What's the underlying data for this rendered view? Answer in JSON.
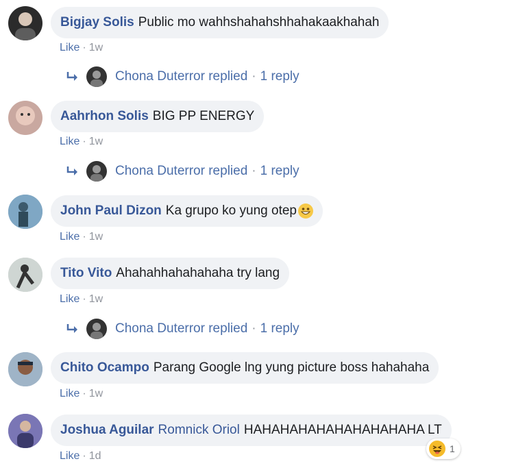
{
  "comments": [
    {
      "author": "Bigjay Solis",
      "text": "Public mo wahhshahahshhahakaakhahah",
      "like": "Like",
      "age": "1w",
      "replies": {
        "name": "Chona Duterror replied",
        "count": "1 reply"
      }
    },
    {
      "author": "Aahrhon Solis",
      "text": "BIG PP ENERGY",
      "like": "Like",
      "age": "1w",
      "replies": {
        "name": "Chona Duterror replied",
        "count": "1 reply"
      }
    },
    {
      "author": "John Paul Dizon",
      "text": "Ka grupo ko yung otep",
      "like": "Like",
      "age": "1w"
    },
    {
      "author": "Tito Vito",
      "text": "Ahahahhahahahaha try lang",
      "like": "Like",
      "age": "1w",
      "replies": {
        "name": "Chona Duterror replied",
        "count": "1 reply"
      }
    },
    {
      "author": "Chito Ocampo",
      "text": "Parang Google lng yung picture boss hahahaha",
      "like": "Like",
      "age": "1w"
    },
    {
      "author": "Joshua Aguilar",
      "mention": "Romnick Oriol",
      "text": "HAHAHAHAHAHAHAHAHAHA LT",
      "like": "Like",
      "age": "1d",
      "reaction": {
        "icon": "haha-reaction-icon",
        "count": "1"
      }
    }
  ],
  "colors": {
    "link": "#385898",
    "bubble": "#f0f2f5",
    "meta": "#90949c"
  }
}
